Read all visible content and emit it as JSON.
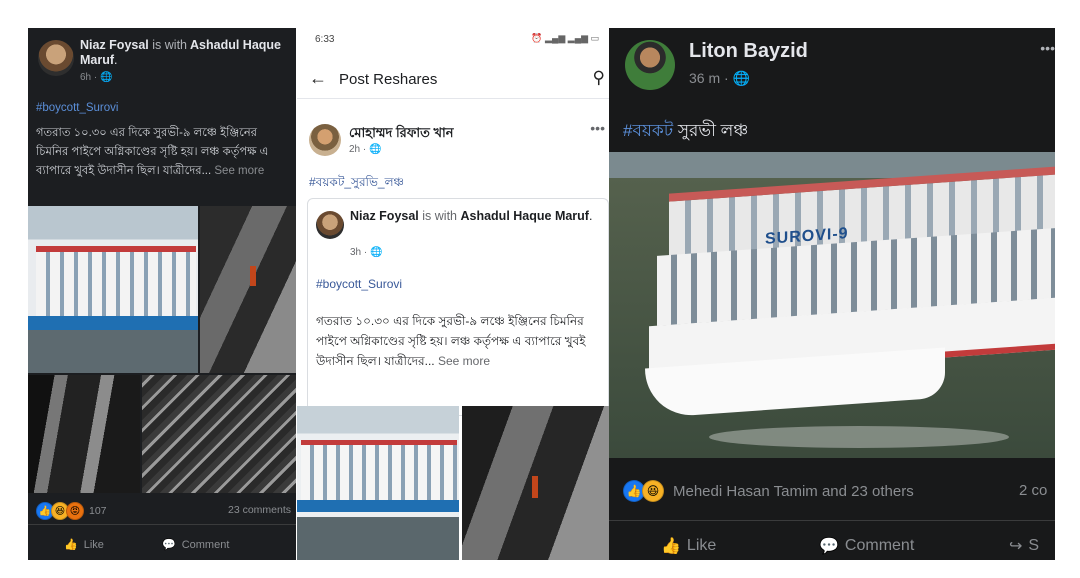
{
  "panel1": {
    "author": "Niaz Foysal",
    "with_text": "is with",
    "tagged": "Ashadul Haque Maruf",
    "time": "6h · ",
    "hashtag": "#boycott_Surovi",
    "body": "গতরাত ১০.৩০ এর দিকে সুরভী-৯ লঞ্চে ইঞ্জিনের চিমনির পাইপে অগ্নিকাণ্ডের সৃষ্টি হয়। লঞ্চ কর্তৃপক্ষ এ ব্যাপারে খুবই উদাসীন ছিল। যাত্রীদের...",
    "see_more": "See more",
    "reaction_count": "107",
    "comments": "23 comments",
    "like": "Like",
    "comment": "Comment"
  },
  "panel2": {
    "status_time": "6:33",
    "header_title": "Post Reshares",
    "author": "মোহাম্মদ রিফাত খান",
    "time": "2h · ",
    "hashtag": "#বয়কট_সুরভি_লঞ্চ",
    "shared": {
      "author": "Niaz Foysal",
      "with_text": "is with",
      "tagged": "Ashadul Haque Maruf",
      "time": "3h · ",
      "hashtag": "#boycott_Surovi",
      "body": "গতরাত ১০.৩০ এর দিকে সুরভী-৯ লঞ্চে ইঞ্জিনের চিমনির পাইপে অগ্নিকাণ্ডের সৃষ্টি হয়। লঞ্চ কর্তৃপক্ষ এ ব্যাপারে খুবই উদাসীন ছিল। যাত্রীদের...",
      "see_more": "See more"
    }
  },
  "panel3": {
    "author": "Liton Bayzid",
    "time": "36 m · ",
    "hashtag": "#বয়কট",
    "title_rest": " সুরভী লঞ্চ",
    "ship_label": "SUROVI-9",
    "reactions_text": "Mehedi Hasan Tamim and 23 others",
    "comments": "2 co",
    "like": "Like",
    "comment": "Comment",
    "share": "S"
  },
  "colors": {
    "fb_blue": "#1877f2",
    "hashtag_dark": "#5b8fd9",
    "dark_bg": "#18191a"
  }
}
